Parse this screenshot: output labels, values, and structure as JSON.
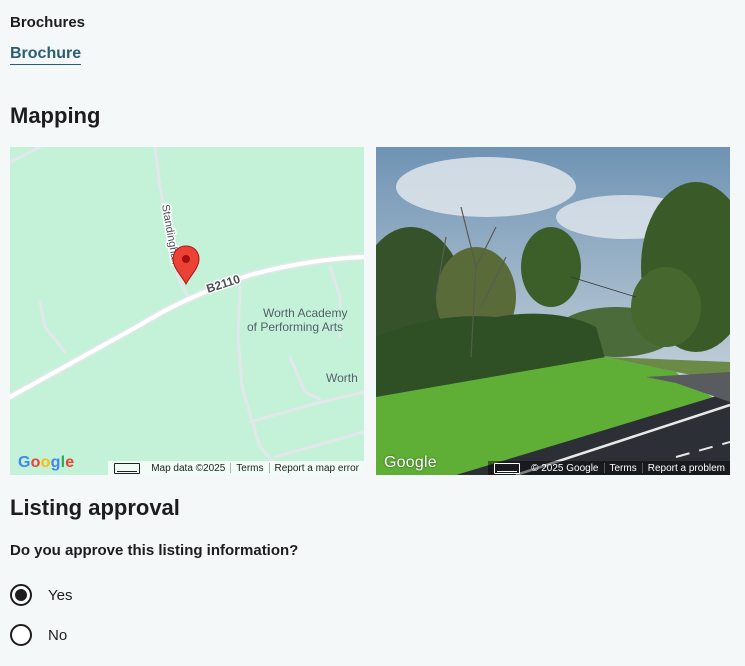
{
  "brochures": {
    "heading": "Brochures",
    "link_label": "Brochure"
  },
  "mapping": {
    "heading": "Mapping",
    "map": {
      "road_label": "B2110",
      "street_label": "Standinghall",
      "place_line1": "Worth Academy",
      "place_line2": "of Performing Arts",
      "town_label": "Worth",
      "logo_text": "Google",
      "map_data": "Map data ©2025",
      "terms": "Terms",
      "report": "Report a map error",
      "background_color": "#c4f2d8",
      "pin_color": "#ea4335"
    },
    "street_view": {
      "logo_text": "Google",
      "copyright": "© 2025 Google",
      "terms": "Terms",
      "report": "Report a problem"
    }
  },
  "approval": {
    "heading": "Listing approval",
    "question": "Do you approve this listing information?",
    "options": [
      {
        "label": "Yes",
        "checked": true
      },
      {
        "label": "No",
        "checked": false
      }
    ]
  }
}
